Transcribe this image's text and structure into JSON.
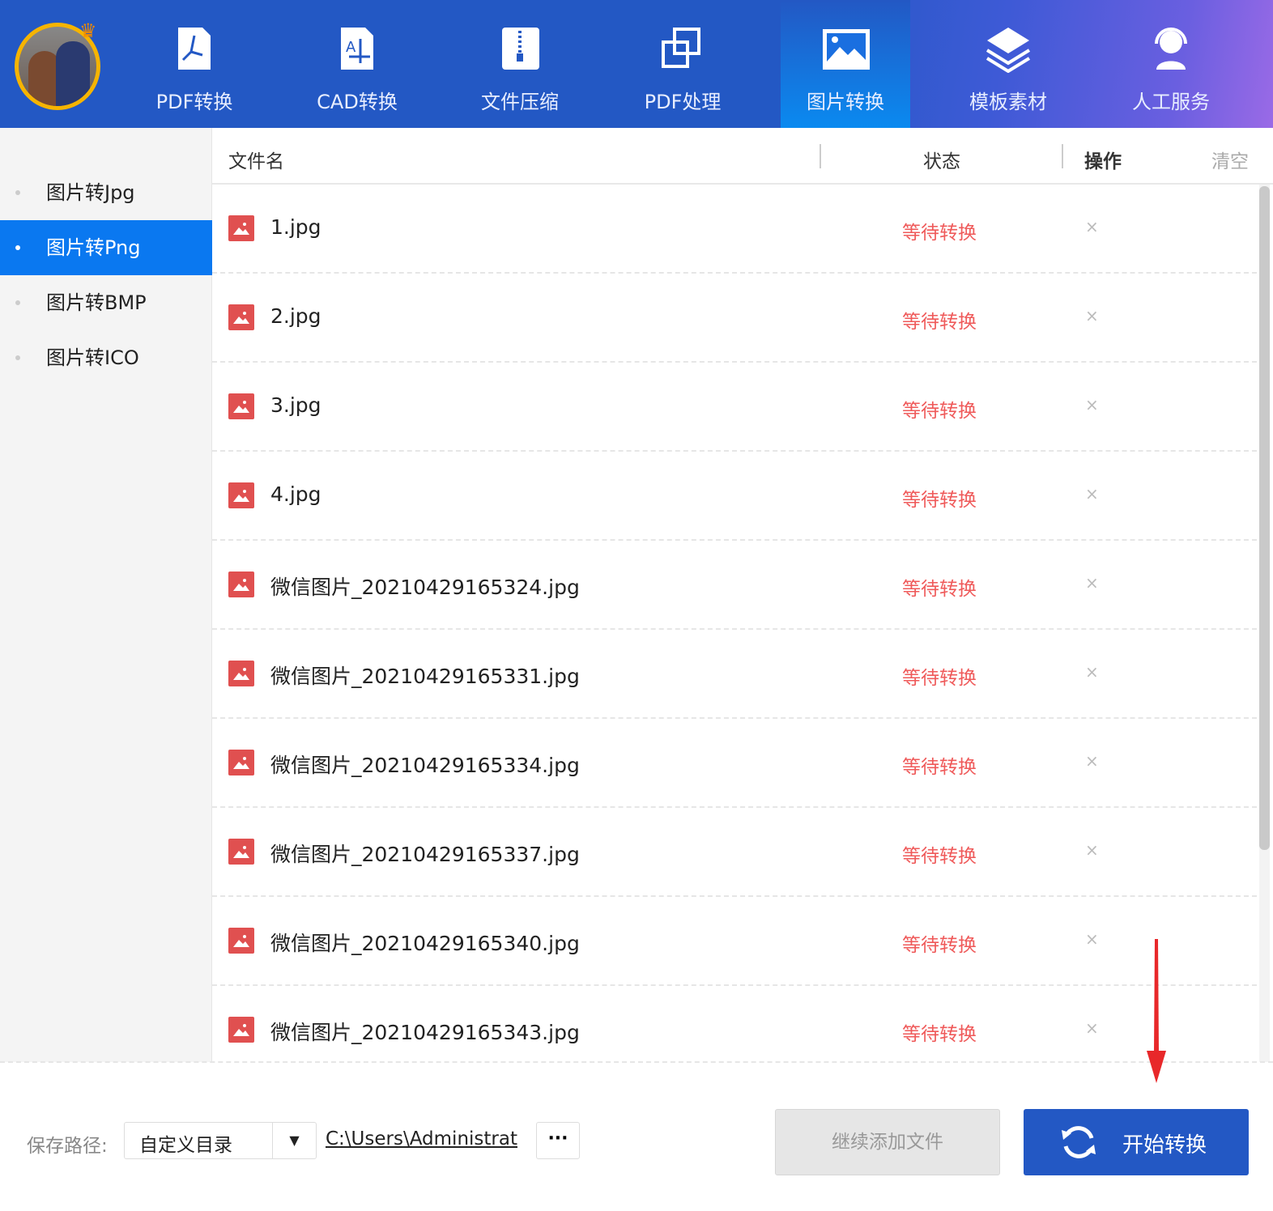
{
  "nav": [
    {
      "label": "PDF转换",
      "icon": "pdf-icon"
    },
    {
      "label": "CAD转换",
      "icon": "cad-icon"
    },
    {
      "label": "文件压缩",
      "icon": "zip-icon"
    },
    {
      "label": "PDF处理",
      "icon": "pdf-process-icon"
    },
    {
      "label": "图片转换",
      "icon": "image-icon",
      "active": true
    },
    {
      "label": "模板素材",
      "icon": "layers-icon"
    },
    {
      "label": "人工服务",
      "icon": "support-icon"
    }
  ],
  "sidebar": [
    {
      "label": "图片转Jpg"
    },
    {
      "label": "图片转Png",
      "active": true
    },
    {
      "label": "图片转BMP"
    },
    {
      "label": "图片转ICO"
    }
  ],
  "table": {
    "headers": {
      "name": "文件名",
      "status": "状态",
      "action": "操作",
      "clear": "清空"
    },
    "rows": [
      {
        "name": "1.jpg",
        "status": "等待转换"
      },
      {
        "name": "2.jpg",
        "status": "等待转换"
      },
      {
        "name": "3.jpg",
        "status": "等待转换"
      },
      {
        "name": "4.jpg",
        "status": "等待转换"
      },
      {
        "name": "微信图片_20210429165324.jpg",
        "status": "等待转换"
      },
      {
        "name": "微信图片_20210429165331.jpg",
        "status": "等待转换"
      },
      {
        "name": "微信图片_20210429165334.jpg",
        "status": "等待转换"
      },
      {
        "name": "微信图片_20210429165337.jpg",
        "status": "等待转换"
      },
      {
        "name": "微信图片_20210429165340.jpg",
        "status": "等待转换"
      },
      {
        "name": "微信图片_20210429165343.jpg",
        "status": "等待转换"
      }
    ],
    "remove_glyph": "×"
  },
  "footer": {
    "save_label": "保存路径:",
    "dir_select": "自定义目录",
    "path": "C:\\Users\\Administrat",
    "browse": "···",
    "add_button": "继续添加文件",
    "start_button": "开始转换"
  },
  "colors": {
    "brand": "#2358c4",
    "active": "#0a78f0",
    "status": "#ef5a5a"
  }
}
